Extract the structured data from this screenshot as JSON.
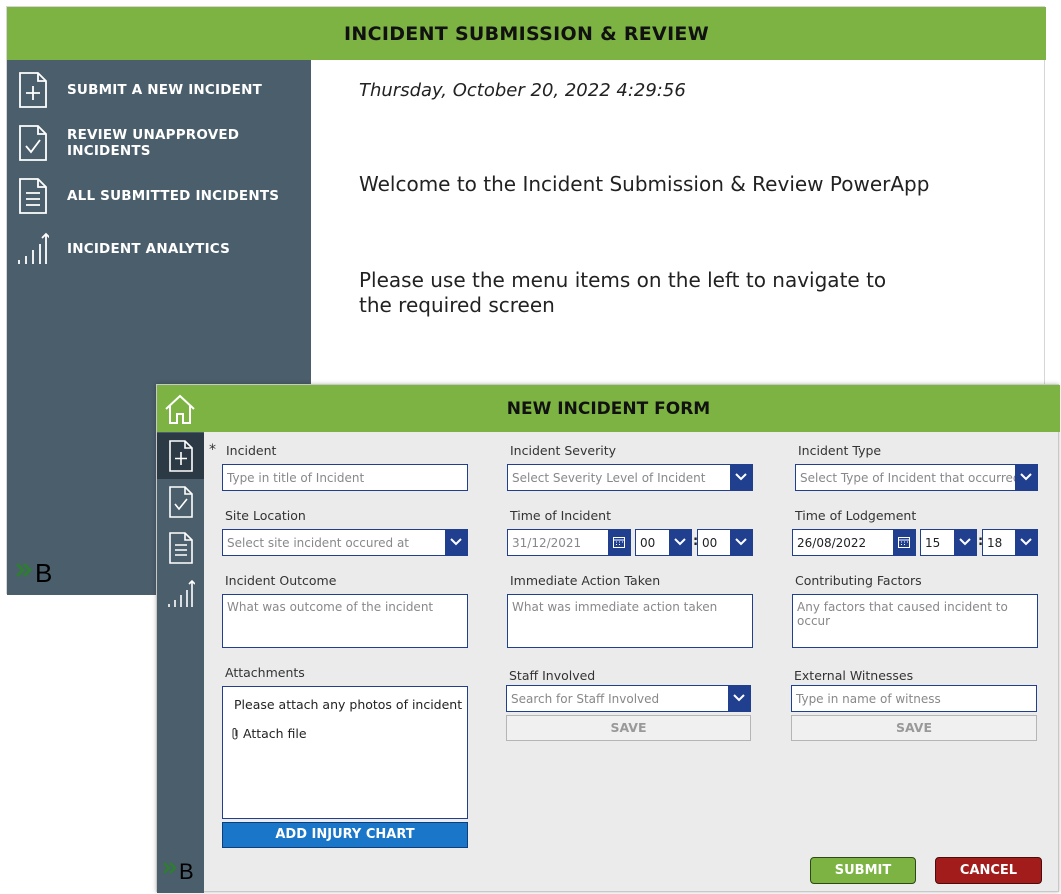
{
  "back_app": {
    "header_title": "INCIDENT SUBMISSION & REVIEW",
    "nav": [
      {
        "label": "SUBMIT A NEW INCIDENT",
        "icon": "document-plus-icon"
      },
      {
        "label": "REVIEW UNAPPROVED INCIDENTS",
        "icon": "document-check-icon"
      },
      {
        "label": "ALL SUBMITTED INCIDENTS",
        "icon": "document-lines-icon"
      },
      {
        "label": "INCIDENT ANALYTICS",
        "icon": "analytics-icon"
      }
    ],
    "datetime": "Thursday, October 20, 2022 4:29:56",
    "welcome": "Welcome to the Incident Submission & Review PowerApp",
    "instructions": "Please use the menu items on the left to navigate to the required screen",
    "logo_text": "B"
  },
  "form": {
    "header_title": "NEW INCIDENT FORM",
    "required_mark": "*",
    "incident": {
      "label": "Incident",
      "placeholder": "Type in title of Incident"
    },
    "severity": {
      "label": "Incident Severity",
      "placeholder": "Select Severity Level of Incident"
    },
    "type": {
      "label": "Incident Type",
      "placeholder": "Select Type of Incident that occurred"
    },
    "site_location": {
      "label": "Site Location",
      "placeholder": "Select site incident occured at"
    },
    "time_of_incident": {
      "label": "Time of Incident",
      "date": "31/12/2021",
      "hour": "00",
      "minute": "00"
    },
    "time_of_lodgement": {
      "label": "Time of Lodgement",
      "date": "26/08/2022",
      "hour": "15",
      "minute": "18"
    },
    "time_separator": ":",
    "outcome": {
      "label": "Incident Outcome",
      "placeholder": "What was outcome of the incident"
    },
    "immediate_action": {
      "label": "Immediate Action Taken",
      "placeholder": "What was immediate action taken"
    },
    "contributing_factors": {
      "label": "Contributing Factors",
      "placeholder": "Any factors that caused incident to occur"
    },
    "attachments": {
      "label": "Attachments",
      "hint": "Please attach any photos of incident",
      "attach_link": "Attach file"
    },
    "add_injury_chart": "ADD INJURY CHART",
    "staff_involved": {
      "label": "Staff Involved",
      "placeholder": "Search for Staff Involved",
      "save": "SAVE"
    },
    "external_witnesses": {
      "label": "External Witnesses",
      "placeholder": "Type in name of witness",
      "save": "SAVE"
    },
    "submit": "SUBMIT",
    "cancel": "CANCEL",
    "logo_text": "B"
  },
  "colors": {
    "header_green": "#7cb342",
    "sidebar_slate": "#4b5e6b",
    "field_border": "#203f8f",
    "button_blue": "#1976c8",
    "cancel_red": "#a31c1c"
  }
}
